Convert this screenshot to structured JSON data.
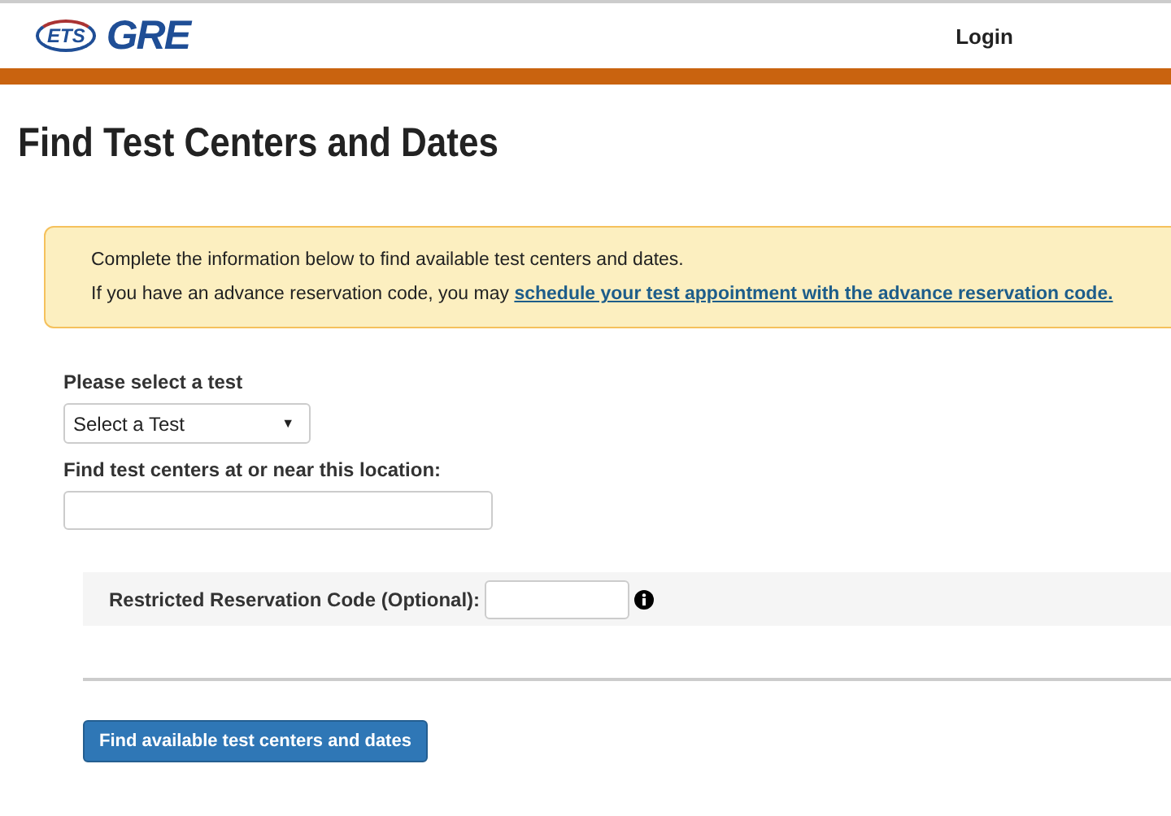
{
  "header": {
    "logo_badge": "ETS",
    "logo_text": "GRE",
    "login": "Login"
  },
  "title": "Find Test Centers and Dates",
  "notice": {
    "line_1": "Complete the information below to find available test centers and dates.",
    "line_2_prefix": "If you have an advance reservation code, you may",
    "line_2_link": "schedule your test appointment with the advance reservation code."
  },
  "test_select": {
    "label": "Please select a test",
    "value": "Select a Test",
    "caret": "▼"
  },
  "location": {
    "label": "Find test centers at or near this location:"
  },
  "reservation": {
    "label": "Restricted Reservation Code (Optional):"
  },
  "submit": "Find available test centers and dates"
}
